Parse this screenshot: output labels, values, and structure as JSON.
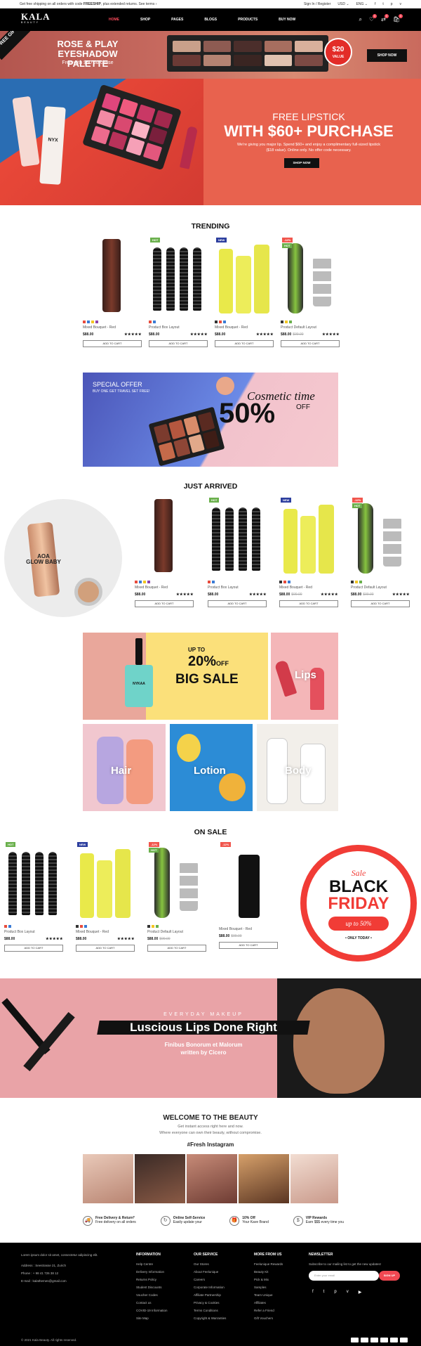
{
  "topbar": {
    "notice_pre": "Get free shipping on all orders with code ",
    "notice_code": "FREESHIP",
    "notice_post": ", plus extended returns. See terms ›",
    "login": "Sign In / Register",
    "currency": "USD ⌄",
    "language": "ENG ⌄"
  },
  "nav": {
    "logo": "KALA",
    "logo_sub": "BEAUTY",
    "items": [
      "HOME",
      "SHOP",
      "PAGES",
      "BLOGS",
      "PRODUCTS",
      "BUY NOW"
    ],
    "wishlist_count": "0",
    "compare_count": "0",
    "cart_count": "0"
  },
  "promo": {
    "ribbon": "FREE GIFT",
    "title": "ROSE & PLAY EYESHADOW PALETTE",
    "subtitle": "Free with $50 purchase",
    "price": "$20",
    "price_sub": "VALUE",
    "button": "SHOP NOW"
  },
  "hero": {
    "line1": "FREE LIPSTICK",
    "line2": "WITH $60+ PURCHASE",
    "desc": "We're giving you major lip. Spend $60+ and enjoy a complimentary full-sized lipstick ($18 value). Online only. No offer code necessary.",
    "button": "SHOP NOW",
    "tube_brand": "NYX"
  },
  "trending": {
    "title": "TRENDING",
    "products": [
      {
        "name": "Mixed Bouquet - Red",
        "price": "$88.00",
        "old": "",
        "tag": "",
        "tag_color": "",
        "cart": "ADD TO CART",
        "swatches": [
          "#e84c3d",
          "#3a7bd5",
          "#f3c623",
          "#8e44ad"
        ],
        "stars": "★★★★★"
      },
      {
        "name": "Product Box Layout",
        "price": "$88.00",
        "old": "",
        "tag": "HOT",
        "tag_color": "#6ab04c",
        "cart": "ADD TO CART",
        "swatches": [
          "#e84c3d",
          "#3a7bd5"
        ],
        "stars": "★★★★★"
      },
      {
        "name": "Mixed Bouquet - Red",
        "price": "$88.00",
        "old": "",
        "tag": "NEW",
        "tag_color": "#2c3e9e",
        "cart": "ADD TO CART",
        "swatches": [
          "#333",
          "#e84c3d",
          "#3a7bd5"
        ],
        "stars": "★★★★★"
      },
      {
        "name": "Product Default Layout",
        "price": "$88.00",
        "old": "$99.00",
        "tag": "-12%",
        "tag_color": "#f1554c",
        "tag2": "HOT",
        "cart": "ADD TO CART",
        "swatches": [
          "#333",
          "#f3c623",
          "#6ab04c"
        ],
        "stars": "★★★★★"
      }
    ]
  },
  "special": {
    "line1": "SPECIAL OFFER",
    "line2": "BUY ONE GET TRAVEL SET FREE!",
    "script": "Cosmetic time",
    "percent": "50%",
    "off": "OFF"
  },
  "arrived": {
    "title": "JUST ARRIVED",
    "feature_text1": "AOA",
    "feature_text2": "GLOW BABY",
    "products": [
      {
        "name": "Mixed Bouquet - Red",
        "price": "$88.00",
        "old": "",
        "tag": "",
        "cart": "ADD TO CART",
        "swatches": [
          "#e84c3d",
          "#3a7bd5",
          "#f3c623",
          "#8e44ad"
        ],
        "stars": "★★★★★"
      },
      {
        "name": "Product Box Layout",
        "price": "$88.00",
        "old": "",
        "tag": "HOT",
        "tag_color": "#6ab04c",
        "cart": "ADD TO CART",
        "swatches": [
          "#e84c3d",
          "#3a7bd5"
        ],
        "stars": "★★★★★"
      },
      {
        "name": "Mixed Bouquet - Red",
        "price": "$88.00",
        "old": "$99.00",
        "tag": "NEW",
        "tag_color": "#2c3e9e",
        "cart": "ADD TO CART",
        "swatches": [
          "#333",
          "#e84c3d",
          "#3a7bd5"
        ],
        "stars": "★★★★★"
      },
      {
        "name": "Product Default Layout",
        "price": "$88.00",
        "old": "$99.00",
        "tag": "-12%",
        "tag_color": "#f1554c",
        "tag2": "HOT",
        "cart": "ADD TO CART",
        "swatches": [
          "#333",
          "#f3c623",
          "#6ab04c"
        ],
        "stars": "★★★★★"
      }
    ]
  },
  "banners": {
    "bigsale_up": "UP TO",
    "bigsale_pct": "20%",
    "bigsale_off": "OFF",
    "bigsale_text": "BIG SALE",
    "polish_brand": "NYKAA",
    "lips": "Lips",
    "hair": "Hair",
    "lotion": "Lotion",
    "body": "Body"
  },
  "onsale": {
    "title": "ON SALE",
    "products": [
      {
        "name": "Product Box Layout",
        "price": "$88.00",
        "old": "",
        "tag": "HOT",
        "tag_color": "#6ab04c",
        "cart": "ADD TO CART",
        "swatches": [
          "#e84c3d",
          "#3a7bd5"
        ],
        "stars": "★★★★★"
      },
      {
        "name": "Mixed Bouquet - Red",
        "price": "$88.00",
        "old": "",
        "tag": "NEW",
        "tag_color": "#2c3e9e",
        "cart": "ADD TO CART",
        "swatches": [
          "#333",
          "#e84c3d",
          "#3a7bd5"
        ],
        "stars": "★★★★★"
      },
      {
        "name": "Product Default Layout",
        "price": "$88.00",
        "old": "$99.00",
        "tag": "-12%",
        "tag_color": "#f1554c",
        "tag2": "HOT",
        "cart": "ADD TO CART",
        "swatches": [
          "#333",
          "#f3c623",
          "#6ab04c"
        ],
        "stars": ""
      },
      {
        "name": "Mixed Bouquet - Red",
        "price": "$88.00",
        "old": "$99.00",
        "tag": "-12%",
        "tag_color": "#f1554c",
        "cart": "ADD TO CART",
        "swatches": [],
        "stars": ""
      }
    ],
    "bf_sale": "Sale",
    "bf_black": "BLACK",
    "bf_friday": "FRIDAY",
    "bf_upto": "up to 50%",
    "bf_only": "• ONLY TODAY •"
  },
  "lipsbanner": {
    "eyebrow": "EVERYDAY MAKEUP",
    "title": "Luscious Lips Done Right",
    "sub1": "Finibus Bonorum et Malorum",
    "sub2": "written by Cicero"
  },
  "welcome": {
    "title": "WELCOME TO THE BEAUTY",
    "line1": "Get instant access right here and now.",
    "line2": "Where everyone can own their beauty, without compromise.",
    "insta": "#Fresh Instagram"
  },
  "features": [
    {
      "icon": "truck-icon",
      "glyph": "🚚",
      "title": "Free Delivery & Return*",
      "sub": "Free delivery on all orders"
    },
    {
      "icon": "support-icon",
      "glyph": "↻",
      "title": "Online Self-Service",
      "sub": "Easily update your"
    },
    {
      "icon": "gift-icon",
      "glyph": "🎁",
      "title": "10% Off",
      "sub": "Your Kave Brand"
    },
    {
      "icon": "reward-icon",
      "glyph": "$",
      "title": "VIP Rewards",
      "sub": "Earn $$$ every time you"
    }
  ],
  "footer": {
    "about": "Lorem ipsum dolor sit amet, consectetur adipiscing elit.",
    "address": "Address : Seestrasse 21, Zurich",
    "phone": "Phone : + 98 41 726 38 12",
    "email": "E-mail : kalathemes@gmail.com",
    "col1_title": "INFORMATION",
    "col1": [
      "Help Centre",
      "Delivery Information",
      "Returns Policy",
      "Student Discounts",
      "Voucher Codes",
      "Contact us",
      "COVID-19 Information",
      "Site Map"
    ],
    "col2_title": "OUR SERVICE",
    "col2": [
      "Our Stores",
      "About Feelunique",
      "Careers",
      "Corporate Information",
      "Affiliate Partnership",
      "Privacy & Cookies",
      "Terms Conditions",
      "Copyright & Warranties"
    ],
    "col3_title": "MORE FROM US",
    "col3": [
      "Feelunique Rewards",
      "Beauty Kit",
      "Pick & Mix",
      "Samples",
      "Team Unique",
      "Affiliates",
      "Refer a Friend",
      "Gift Vouchers"
    ],
    "news_title": "NEWSLETTER",
    "news_desc": "Subscribe to our mailing list to get the new updates!",
    "email_placeholder": "Enter your email",
    "signup": "SIGN UP",
    "copyright": "© 2021 Kala Beauty. All rights reserved."
  }
}
